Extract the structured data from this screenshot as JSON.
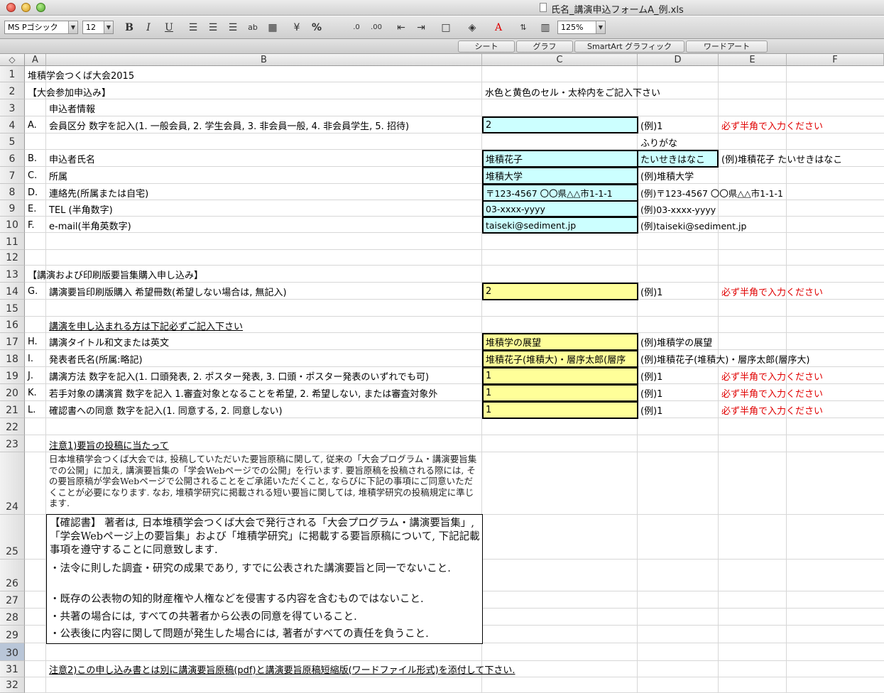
{
  "window": {
    "title": "氏名_講演申込フォームA_例.xls"
  },
  "toolbar": {
    "font_name": "MS Pゴシック",
    "font_size": "12",
    "zoom": "125%",
    "buttons": {
      "bold": "B",
      "italic": "I",
      "underline": "U",
      "percent": "%"
    }
  },
  "ribbon": {
    "tabs": [
      "シート",
      "グラフ",
      "SmartArt グラフィック",
      "ワードアート"
    ]
  },
  "columns": [
    "A",
    "B",
    "C",
    "D",
    "E",
    "F"
  ],
  "rows": [
    "1",
    "2",
    "3",
    "4",
    "5",
    "6",
    "7",
    "8",
    "9",
    "10",
    "11",
    "12",
    "13",
    "14",
    "15",
    "16",
    "17",
    "18",
    "19",
    "20",
    "21",
    "22",
    "23",
    "24",
    "25",
    "26",
    "27",
    "28",
    "29",
    "30",
    "31",
    "32"
  ],
  "cells": {
    "r1b": "堆積学会つくば大会2015",
    "r2b": "【大会参加申込み】",
    "r2c": "水色と黄色のセル・太枠内をご記入下さい",
    "r3b": "申込者情報",
    "r4a": "A.",
    "r4b": "会員区分  数字を記入(1. 一般会員, 2. 学生会員, 3. 非会員一般, 4. 非会員学生, 5. 招待)",
    "r4c": "2",
    "r4d": "(例)1",
    "r4e": "必ず半角で入力ください",
    "r5d": "ふりがな",
    "r6a": "B.",
    "r6b": "申込者氏名",
    "r6c": "堆積花子",
    "r6d": "たいせきはなこ",
    "r6e": "(例)堆積花子  たいせきはなこ",
    "r7a": "C.",
    "r7b": "所属",
    "r7c": "堆積大学",
    "r7d": "(例)堆積大学",
    "r8a": "D.",
    "r8b": "連絡先(所属または自宅)",
    "r8c": "〒123-4567 〇〇県△△市1-1-1",
    "r8d": "(例)〒123-4567 〇〇県△△市1-1-1",
    "r9a": "E.",
    "r9b": "TEL (半角数字)",
    "r9c": "03-xxxx-yyyy",
    "r9d": "(例)03-xxxx-yyyy",
    "r10a": "F.",
    "r10b": "e-mail(半角英数字)",
    "r10c": "taiseki@sediment.jp",
    "r10d": "(例)taiseki@sediment.jp",
    "r13b": "【講演および印刷版要旨集購入申し込み】",
    "r14a": "G.",
    "r14b": "講演要旨印刷版購入  希望冊数(希望しない場合は, 無記入)",
    "r14c": "2",
    "r14d": "(例)1",
    "r14e": "必ず半角で入力ください",
    "r16b": "講演を申し込まれる方は下記必ずご記入下さい",
    "r17a": "H.",
    "r17b": "講演タイトル和文または英文",
    "r17c": "堆積学の展望",
    "r17d": "(例)堆積学の展望",
    "r18a": "I.",
    "r18b": "発表者氏名(所属:略記)",
    "r18c": "堆積花子(堆積大)・層序太郎(層序",
    "r18d": "(例)堆積花子(堆積大)・層序太郎(層序大)",
    "r19a": "J.",
    "r19b": "講演方法  数字を記入(1. 口頭発表, 2. ポスター発表, 3. 口頭・ポスター発表のいずれでも可)",
    "r19c": "1",
    "r19d": "(例)1",
    "r19e": "必ず半角で入力ください",
    "r20a": "K.",
    "r20b": "若手対象の講演賞 数字を記入  1.審査対象となることを希望, 2. 希望しない, または審査対象外",
    "r20c": "1",
    "r20d": "(例)1",
    "r20e": "必ず半角で入力ください",
    "r21a": "L.",
    "r21b": "確認書への同意  数字を記入(1. 同意する, 2. 同意しない)",
    "r21c": "1",
    "r21d": "(例)1",
    "r21e": "必ず半角で入力ください",
    "r23b": "注意1)要旨の投稿に当たって",
    "r24b": "日本堆積学会つくば大会では, 投稿していただいた要旨原稿に関して, 従来の「大会プログラム・講演要旨集での公開」に加え, 講演要旨集の「学会Webページでの公開」を行います. 要旨原稿を投稿される際には, その要旨原稿が学会Webページで公開されることをご承諾いただくこと, ならびに下記の事項にご同意いただくことが必要になります. なお, 堆積学研究に掲載される短い要旨に関しては, 堆積学研究の投稿規定に準じます.",
    "r25b": "【確認書】 著者は, 日本堆積学会つくば大会で発行される「大会プログラム・講演要旨集」, 「学会Webページ上の要旨集」および「堆積学研究」に掲載する要旨原稿について, 下記記載事項を遵守することに同意致します.",
    "r26b": "・法令に則した調査・研究の成果であり, すでに公表された講演要旨と同一でないこと.",
    "r27b": "・既存の公表物の知的財産権や人権などを侵害する内容を含むものではないこと.",
    "r28b": "・共著の場合には, すべての共著者から公表の同意を得ていること.",
    "r29b": "・公表後に内容に関して問題が発生した場合には, 著者がすべての責任を負うこと.",
    "r31b": "注意2)この申し込み書とは別に講演要旨原稿(pdf)と講演要旨原稿短縮版(ワードファイル形式)を添付して下さい."
  },
  "colors": {
    "cyan_input": "#ccffff",
    "yellow_input": "#ffff99",
    "warning_text": "#e00000"
  }
}
